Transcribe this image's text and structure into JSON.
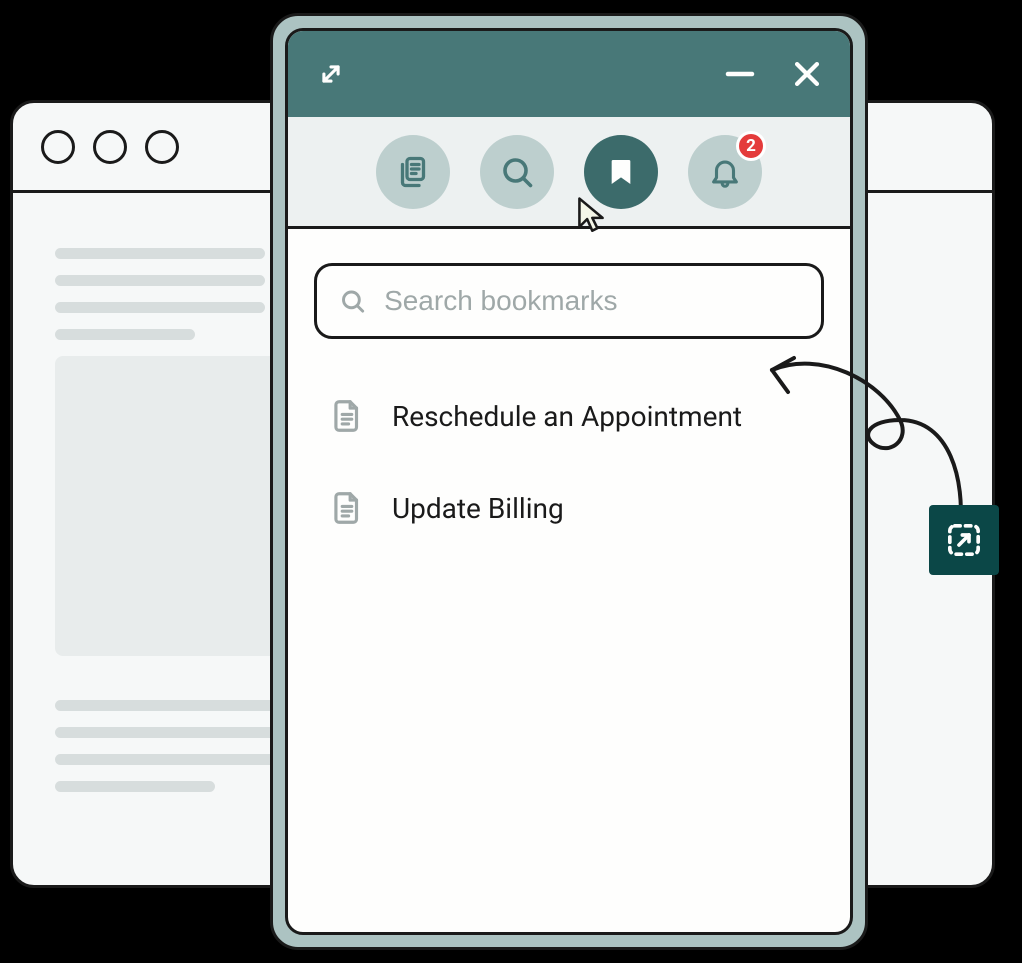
{
  "colors": {
    "teal_dark": "#487878",
    "teal_deep": "#0B4747",
    "teal_muted": "#ACC3C2",
    "toolbar_bg": "#EDF1F1",
    "pill_bg": "#BDCFCE",
    "badge_red": "#E43B3B",
    "offwhite": "#FEFEFD",
    "stroke": "#1A1A1A",
    "skeleton_line": "#D7DDDD",
    "skeleton_block": "#E8ECEC",
    "placeholder": "#9FA8A8"
  },
  "panel": {
    "toolbar": {
      "tabs": [
        {
          "id": "documents",
          "icon": "documents-icon",
          "active": false
        },
        {
          "id": "search",
          "icon": "search-icon",
          "active": false
        },
        {
          "id": "bookmarks",
          "icon": "bookmark-icon",
          "active": true
        },
        {
          "id": "notifications",
          "icon": "bell-icon",
          "active": false,
          "badge": "2"
        }
      ]
    },
    "search": {
      "placeholder": "Search bookmarks",
      "value": ""
    },
    "bookmarks": [
      {
        "label": "Reschedule an Appointment"
      },
      {
        "label": "Update Billing"
      }
    ]
  }
}
